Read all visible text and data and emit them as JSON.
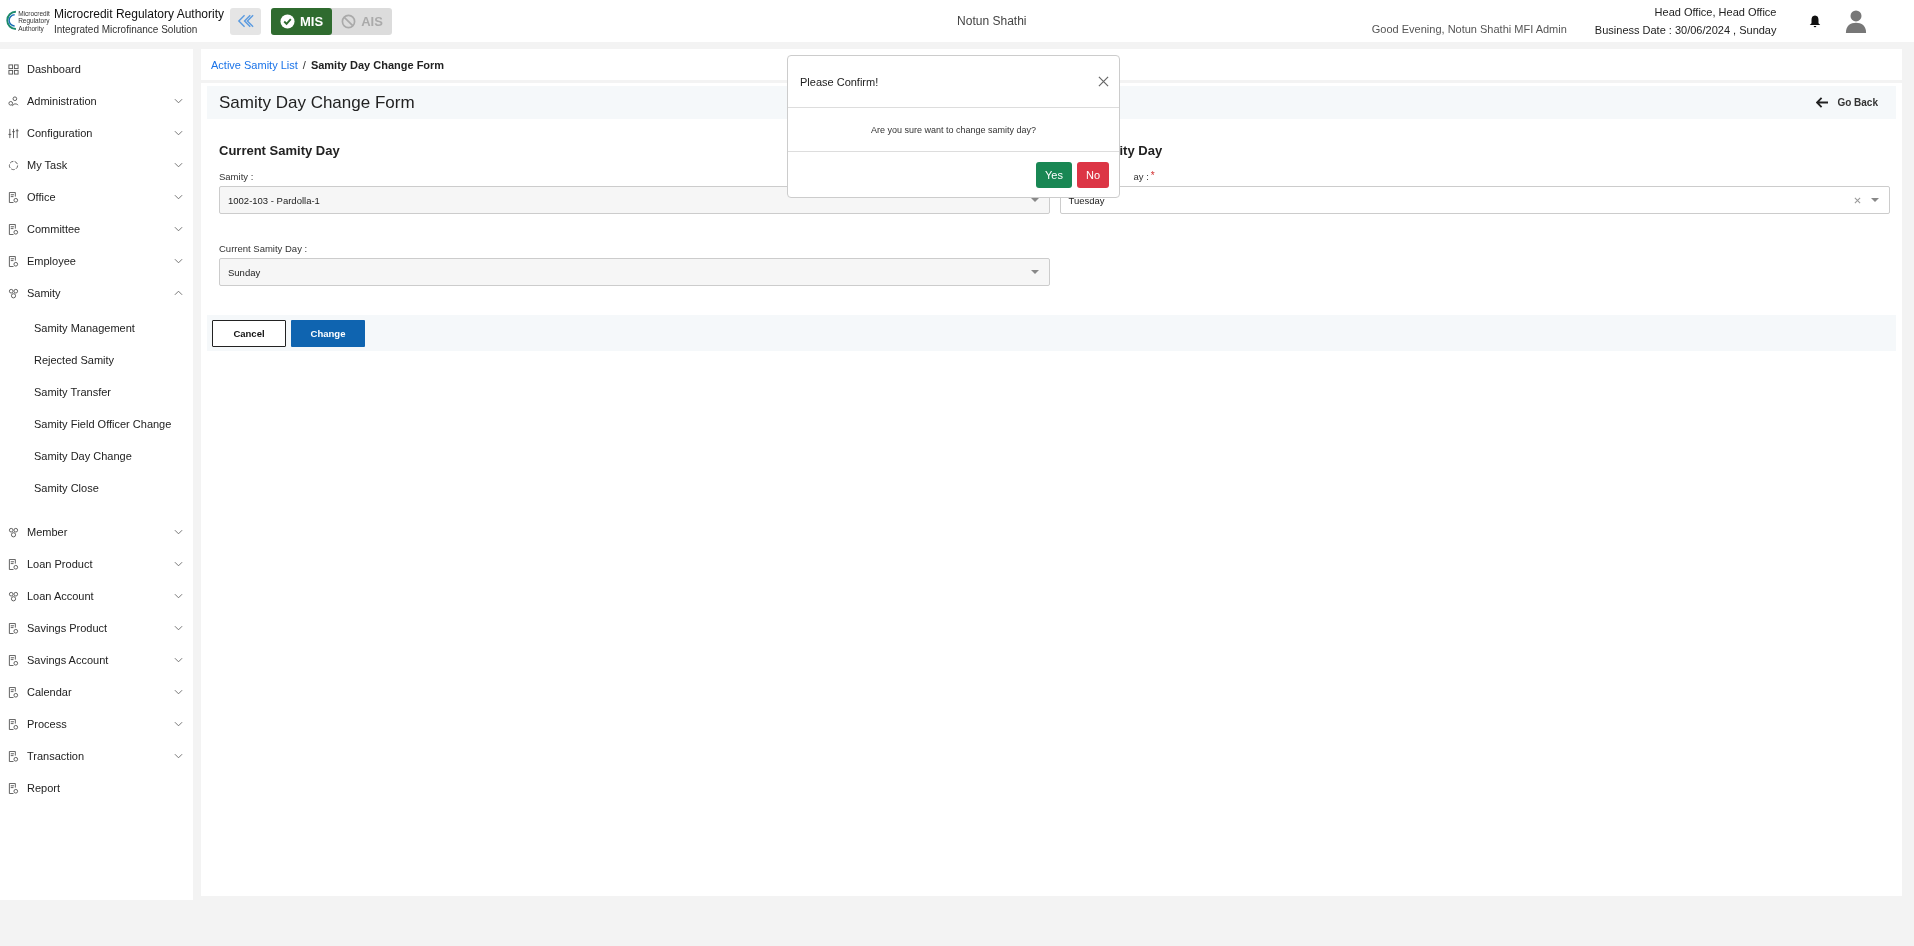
{
  "header": {
    "brand_title": "Microcredit Regulatory Authority",
    "brand_subtitle": "Integrated Microfinance Solution",
    "logo_text": [
      "Microcredit",
      "Regulatory",
      "Authority"
    ],
    "modules": [
      {
        "label": "MIS",
        "selected": true
      },
      {
        "label": "AIS",
        "selected": false
      }
    ],
    "center_title": "Notun Shathi",
    "greeting": "Good Evening, Notun Shathi MFI Admin",
    "office": "Head Office, Head Office",
    "business_date": "Business Date : 30/06/2024 , Sunday"
  },
  "sidebar": {
    "items": [
      {
        "label": "Dashboard"
      },
      {
        "label": "Administration",
        "expanded": false
      },
      {
        "label": "Configuration",
        "expanded": false
      },
      {
        "label": "My Task",
        "expanded": false
      },
      {
        "label": "Office",
        "expanded": false
      },
      {
        "label": "Committee",
        "expanded": false
      },
      {
        "label": "Employee",
        "expanded": false
      },
      {
        "label": "Samity",
        "expanded": true,
        "children": [
          {
            "label": "Samity Management"
          },
          {
            "label": "Rejected Samity"
          },
          {
            "label": "Samity Transfer"
          },
          {
            "label": "Samity Field Officer Change"
          },
          {
            "label": "Samity Day Change"
          },
          {
            "label": "Samity Close"
          }
        ]
      },
      {
        "label": "Member",
        "expanded": false
      },
      {
        "label": "Loan Product",
        "expanded": false
      },
      {
        "label": "Loan Account",
        "expanded": false
      },
      {
        "label": "Savings Product",
        "expanded": false
      },
      {
        "label": "Savings Account",
        "expanded": false
      },
      {
        "label": "Calendar",
        "expanded": false
      },
      {
        "label": "Process",
        "expanded": false
      },
      {
        "label": "Transaction",
        "expanded": false
      },
      {
        "label": "Report"
      }
    ]
  },
  "breadcrumb": {
    "link": "Active Samity List",
    "separator": "/",
    "current": "Samity Day Change Form"
  },
  "page_title": "Samity Day Change Form",
  "go_back": "Go Back",
  "form": {
    "left": {
      "heading": "Current Samity Day",
      "fields": [
        {
          "label": "Samity :",
          "value": "1002-103 - Pardolla-1"
        },
        {
          "label": "Current Samity Day :",
          "value": "Sunday"
        }
      ]
    },
    "right": {
      "heading": "ity Day",
      "label": "ay :",
      "required_mark": "*",
      "value": "Tuesday"
    }
  },
  "buttons": [
    {
      "label": "Cancel",
      "kind": "outline"
    },
    {
      "label": "Change",
      "kind": "primary"
    }
  ],
  "modal": {
    "title": "Please Confirm!",
    "message": "Are you sure want to change samity day?",
    "buttons": [
      {
        "label": "Yes",
        "kind": "success"
      },
      {
        "label": "No",
        "kind": "danger"
      }
    ]
  }
}
